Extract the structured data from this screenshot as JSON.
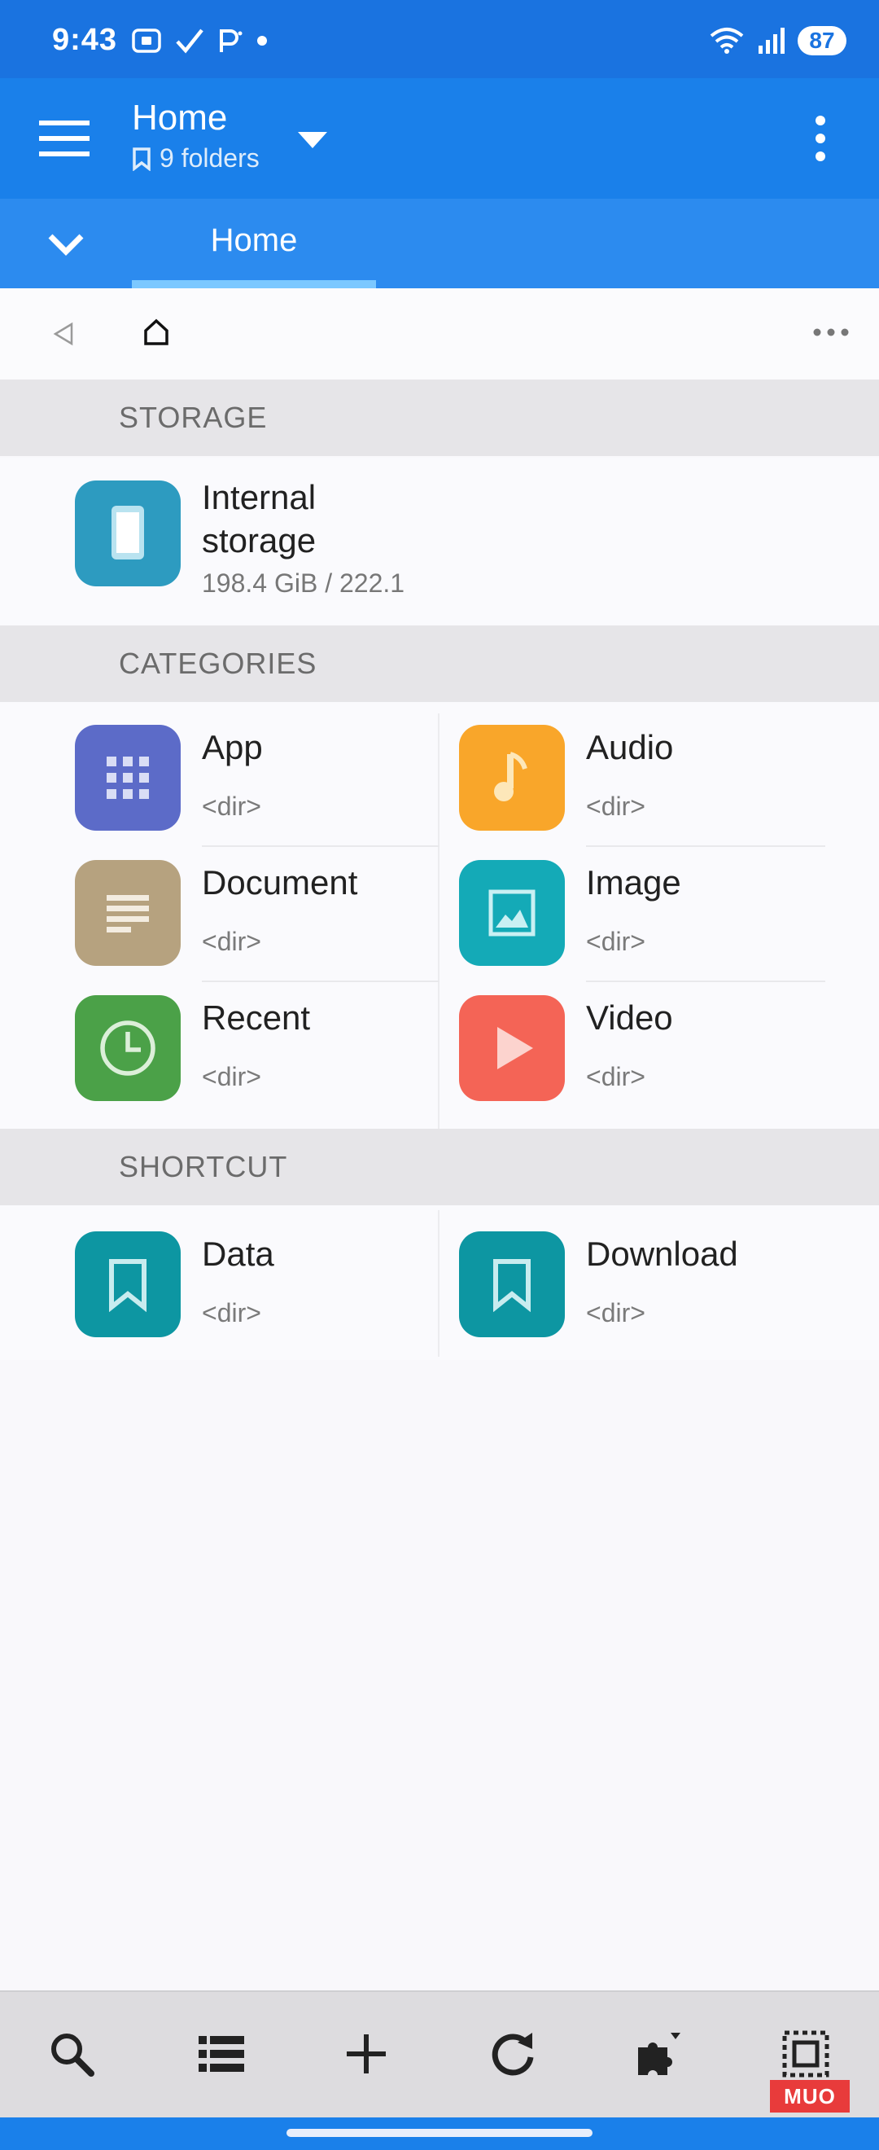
{
  "status_bar": {
    "time": "9:43",
    "battery": "87"
  },
  "app_bar": {
    "title": "Home",
    "subtitle": "9 folders"
  },
  "tabs": [
    {
      "label": "Home"
    }
  ],
  "sections": {
    "storage": "STORAGE",
    "categories": "CATEGORIES",
    "shortcut": "SHORTCUT"
  },
  "storage": {
    "name": "Internal storage",
    "size": "198.4 GiB / 222.1",
    "color": "#2d9bc0"
  },
  "categories": [
    {
      "name": "App",
      "sub": "<dir>",
      "color": "#5c6bc8",
      "icon": "apps-grid-icon"
    },
    {
      "name": "Audio",
      "sub": "<dir>",
      "color": "#f9a62a",
      "icon": "music-note-icon"
    },
    {
      "name": "Document",
      "sub": "<dir>",
      "color": "#b6a27f",
      "icon": "document-icon"
    },
    {
      "name": "Image",
      "sub": "<dir>",
      "color": "#14aab7",
      "icon": "image-icon"
    },
    {
      "name": "Recent",
      "sub": "<dir>",
      "color": "#4ba148",
      "icon": "clock-icon"
    },
    {
      "name": "Video",
      "sub": "<dir>",
      "color": "#f46456",
      "icon": "play-icon"
    }
  ],
  "shortcuts": [
    {
      "name": "Data",
      "sub": "<dir>",
      "color": "#0d96a2",
      "icon": "bookmark-icon"
    },
    {
      "name": "Download",
      "sub": "<dir>",
      "color": "#0d96a2",
      "icon": "bookmark-icon"
    }
  ],
  "bottom_bar": [
    {
      "icon": "search-icon"
    },
    {
      "icon": "list-view-icon"
    },
    {
      "icon": "add-icon"
    },
    {
      "icon": "refresh-icon"
    },
    {
      "icon": "plugin-icon"
    },
    {
      "icon": "select-icon"
    }
  ],
  "watermark": "MUO",
  "colors": {
    "status_bar": "#1a73e0",
    "app_bar": "#1a80ea",
    "tab_bar": "#2c8bef",
    "tab_indicator": "#7cc8ff"
  }
}
